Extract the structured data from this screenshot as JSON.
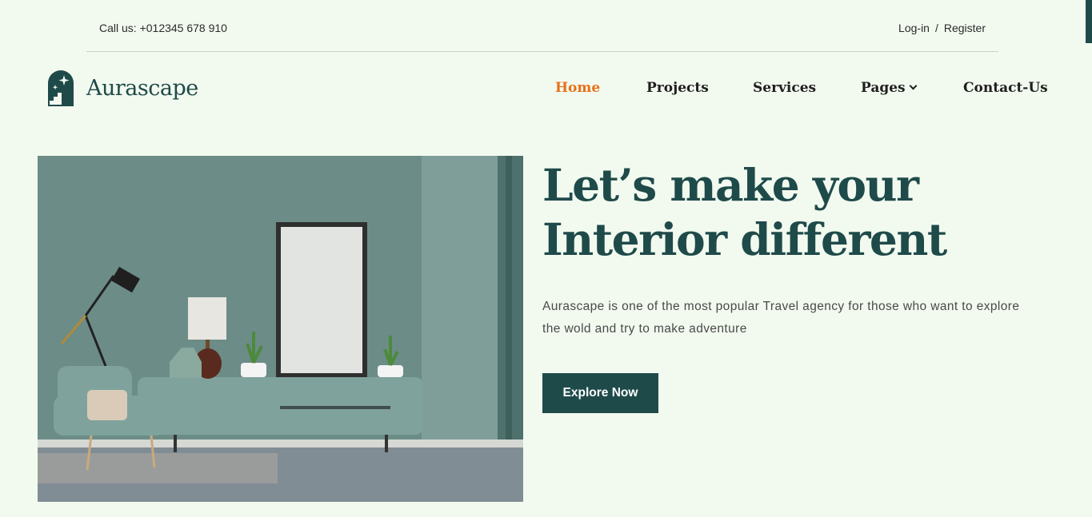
{
  "topbar": {
    "call": "Call us: +012345 678 910",
    "login": "Log-in",
    "separator": "/",
    "register": "Register"
  },
  "brand": {
    "name": "Aurascape",
    "icon": "arch-stairs-sparkle-icon"
  },
  "nav": {
    "items": [
      {
        "label": "Home",
        "active": true
      },
      {
        "label": "Projects",
        "active": false
      },
      {
        "label": "Services",
        "active": false
      },
      {
        "label": "Pages",
        "active": false,
        "dropdown": true
      },
      {
        "label": "Contact-Us",
        "active": false
      }
    ]
  },
  "hero": {
    "headline_line1": "Let’s make your",
    "headline_line2": "Interior different",
    "description": "Aurascape is one of the most popular Travel agency for those who want to explore the wold and try to make adventure",
    "cta": "Explore Now"
  },
  "colors": {
    "background": "#f2faef",
    "primary": "#1f4a4a",
    "accent": "#e8701a"
  }
}
